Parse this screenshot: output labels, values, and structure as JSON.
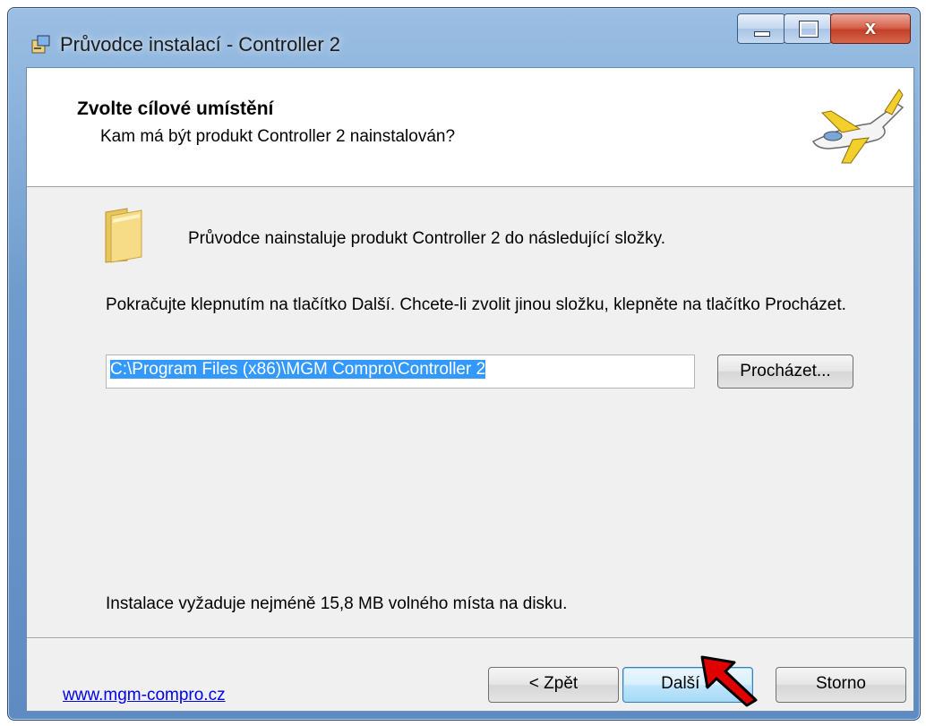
{
  "window": {
    "title": "Průvodce instalací - Controller 2",
    "close_glyph": "x"
  },
  "header": {
    "title": "Zvolte cílové umístění",
    "subtitle": "Kam má být produkt Controller 2 nainstalován?",
    "logo_icon": "airplane-icon"
  },
  "content": {
    "folder_icon": "folder-icon",
    "intro": "Průvodce nainstaluje produkt Controller 2 do následující složky.",
    "instructions": "Pokračujte klepnutím na tlačítko Další. Chcete-li zvolit jinou složku, klepněte na tlačítko Procházet.",
    "path_value": "C:\\Program Files (x86)\\MGM Compro\\Controller 2",
    "browse_label": "Procházet...",
    "space_required": "Instalace vyžaduje nejméně 15,8 MB volného místa na disku."
  },
  "footer": {
    "link": "www.mgm-compro.cz",
    "back_label": "< Zpět",
    "next_label": "Další >",
    "cancel_label": "Storno"
  },
  "colors": {
    "selection": "#3399ff",
    "pointer_arrow": "#e00000",
    "link": "#0000ee"
  }
}
